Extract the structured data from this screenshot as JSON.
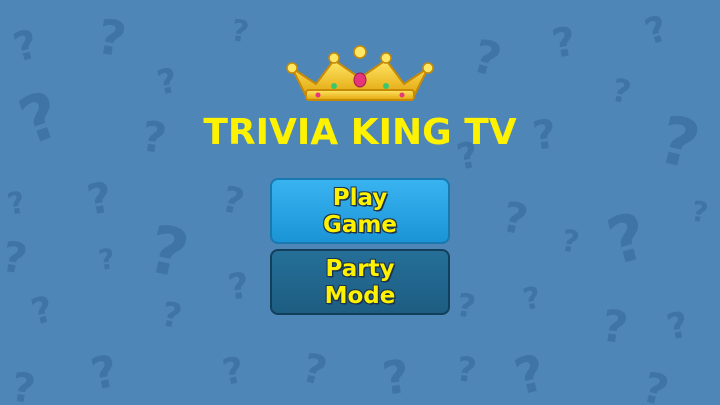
{
  "game": {
    "title": "TRIVIA KING TV",
    "play_line1": "Play",
    "play_line2": "Game",
    "party_line1": "Party",
    "party_line2": "Mode"
  },
  "colors": {
    "background": "#4f86b8",
    "title": "#fff200",
    "play_button": "#29a3e3",
    "party_button": "#216790"
  },
  "icons": [
    "crown-icon",
    "question-mark-pattern"
  ]
}
